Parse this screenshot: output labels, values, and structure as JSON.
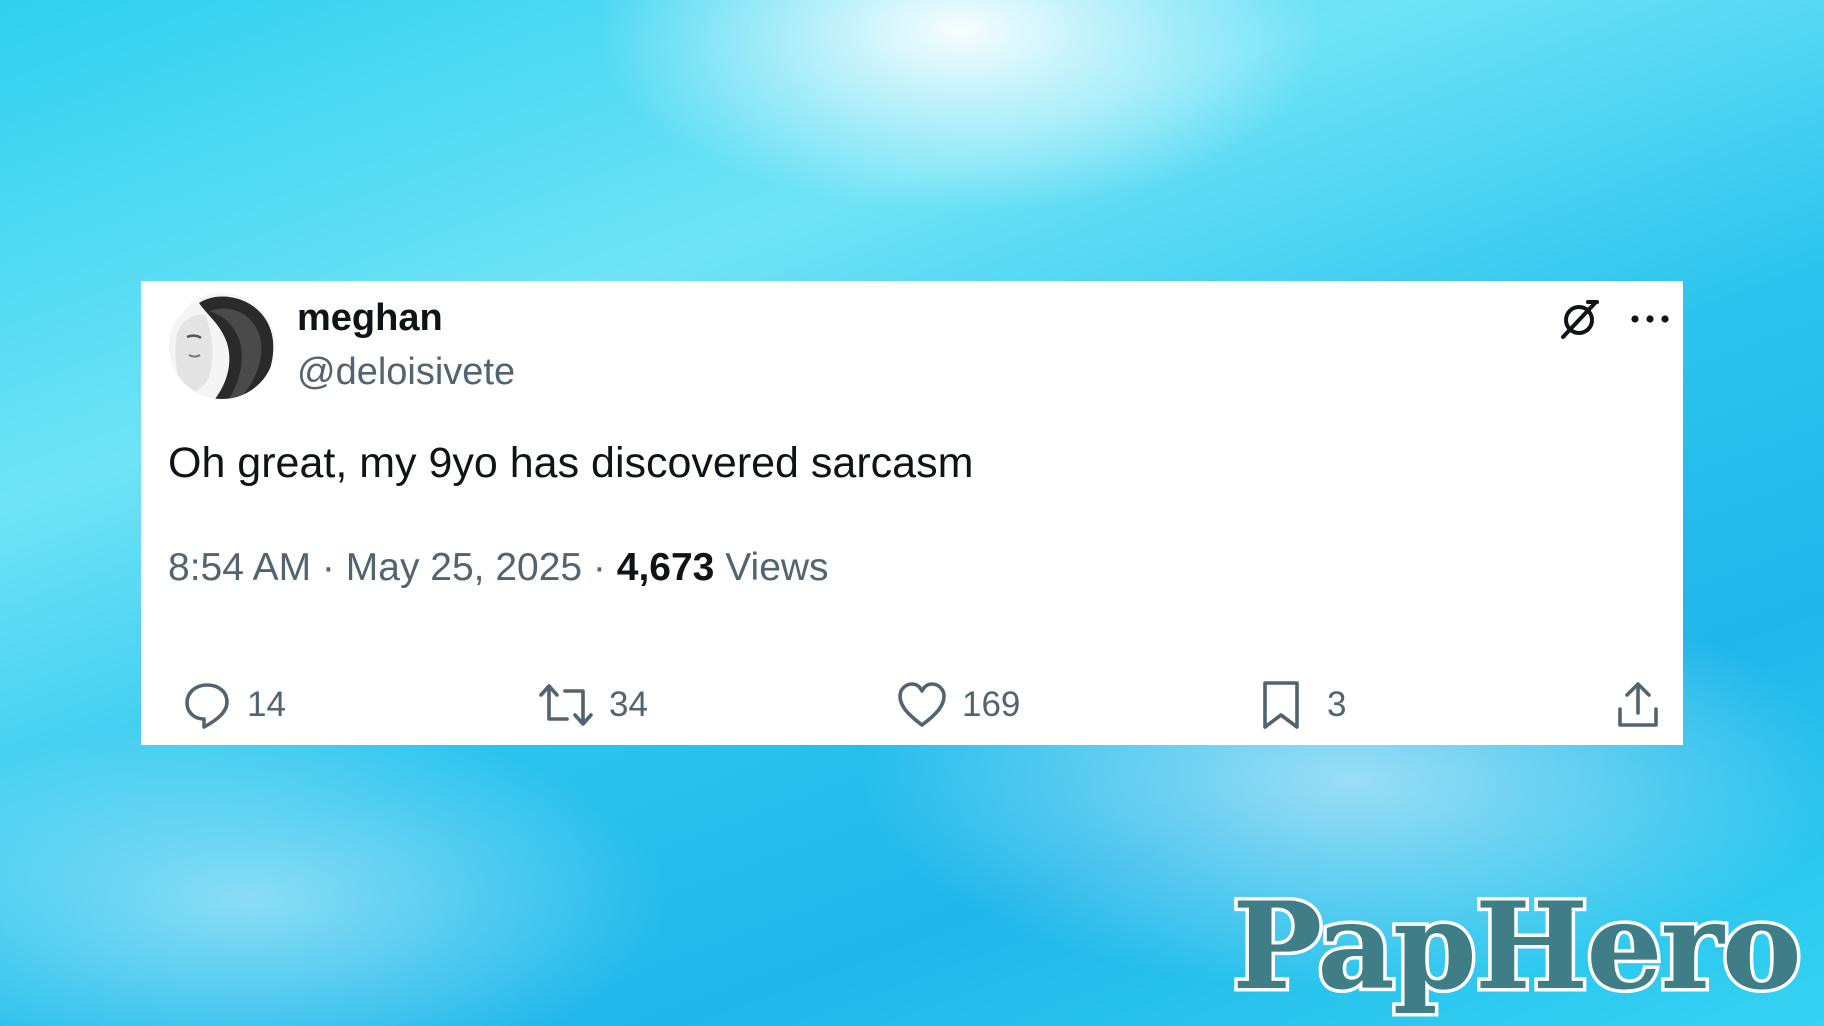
{
  "tweet": {
    "author_name": "meghan",
    "author_handle": "@deloisivete",
    "text": "Oh great, my 9yo has discovered sarcasm",
    "time": "8:54 AM",
    "date": "May 25, 2025",
    "separator": " · ",
    "views_count": "4,673",
    "views_label": "Views"
  },
  "actions": {
    "replies": "14",
    "reposts": "34",
    "likes": "169",
    "bookmarks": "3"
  },
  "icons": {
    "grok": "grok-icon",
    "more": "more-options-icon",
    "reply": "reply-icon",
    "repost": "repost-icon",
    "like": "heart-icon",
    "bookmark": "bookmark-icon",
    "share": "share-icon"
  },
  "watermark": {
    "text": "PapHero",
    "color": "#3f7d87"
  },
  "colors": {
    "text_primary": "#0f1419",
    "text_secondary": "#536471",
    "card_background": "#ffffff",
    "background_accent": "#2fd0ef"
  }
}
